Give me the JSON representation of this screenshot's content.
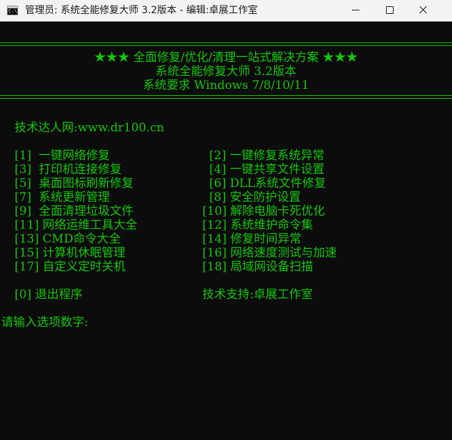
{
  "window": {
    "title": "管理员:  系统全能修复大师 3.2版本 - 编辑:卓展工作室",
    "icon": "console-icon",
    "icon_prompt": "C:\\_",
    "controls": {
      "minimize": "minimize-icon",
      "maximize": "maximize-icon",
      "close": "close-icon"
    }
  },
  "colors": {
    "console_bg": "#0c0c0c",
    "console_text": "#16c60c",
    "titlebar_bg": "#f3f3f3"
  },
  "header": {
    "slogan": "★★★ 全面修复/优化/清理一站式解决方案 ★★★",
    "app_name": "系统全能修复大师 3.2版本",
    "requirement": "系统要求 Windows 7/8/10/11"
  },
  "website": "技术达人网:www.dr100.cn",
  "menu": {
    "left": [
      "[1]  一键网络修复",
      "[3]  打印机连接修复",
      "[5]  桌面图标刷新修复",
      "[7]  系统更新管理",
      "[9]  全面清理垃圾文件",
      "[11] 网络运维工具大全",
      "[13] CMD命令大全",
      "[15] 计算机休眠管理",
      "[17] 自定义定时关机"
    ],
    "right": [
      "[2] 一键修复系统异常",
      "[4] 一键共享文件设置",
      "[6] DLL系统文件修复",
      "[8] 安全防护设置",
      "[10] 解除电脑卡死优化",
      "[12] 系统维护命令集",
      "[14] 修复时间异常",
      "[16] 网络速度测试与加速",
      "[18] 局域网设备扫描"
    ]
  },
  "exit_option": "[0] 退出程序",
  "support": "技术支持:卓展工作室",
  "input_prompt": "请输入选项数字:"
}
